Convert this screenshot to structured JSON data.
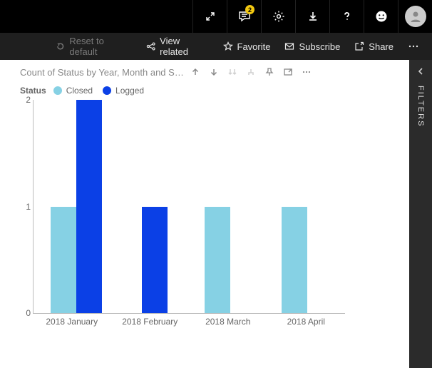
{
  "topbar1": {
    "notification_count": "2"
  },
  "topbar2": {
    "reset": "Reset to default",
    "view_related": "View related",
    "favorite": "Favorite",
    "subscribe": "Subscribe",
    "share": "Share"
  },
  "viz": {
    "title": "Count of Status by Year, Month and St..."
  },
  "legend": {
    "label": "Status",
    "series0": "Closed",
    "series1": "Logged"
  },
  "filters_label": "FILTERS",
  "yticks": {
    "t0": "0",
    "t1": "1",
    "t2": "2"
  },
  "xticks": {
    "x0": "2018 January",
    "x1": "2018 February",
    "x2": "2018 March",
    "x3": "2018 April"
  },
  "chart_data": {
    "type": "bar",
    "title": "Count of Status by Year, Month and Status",
    "xlabel": "",
    "ylabel": "",
    "ylim": [
      0,
      2
    ],
    "categories": [
      "2018 January",
      "2018 February",
      "2018 March",
      "2018 April"
    ],
    "series": [
      {
        "name": "Closed",
        "color": "#86d1e4",
        "values": [
          1,
          0,
          1,
          1
        ]
      },
      {
        "name": "Logged",
        "color": "#0b40e6",
        "values": [
          2,
          1,
          0,
          0
        ]
      }
    ],
    "legend_position": "top"
  }
}
